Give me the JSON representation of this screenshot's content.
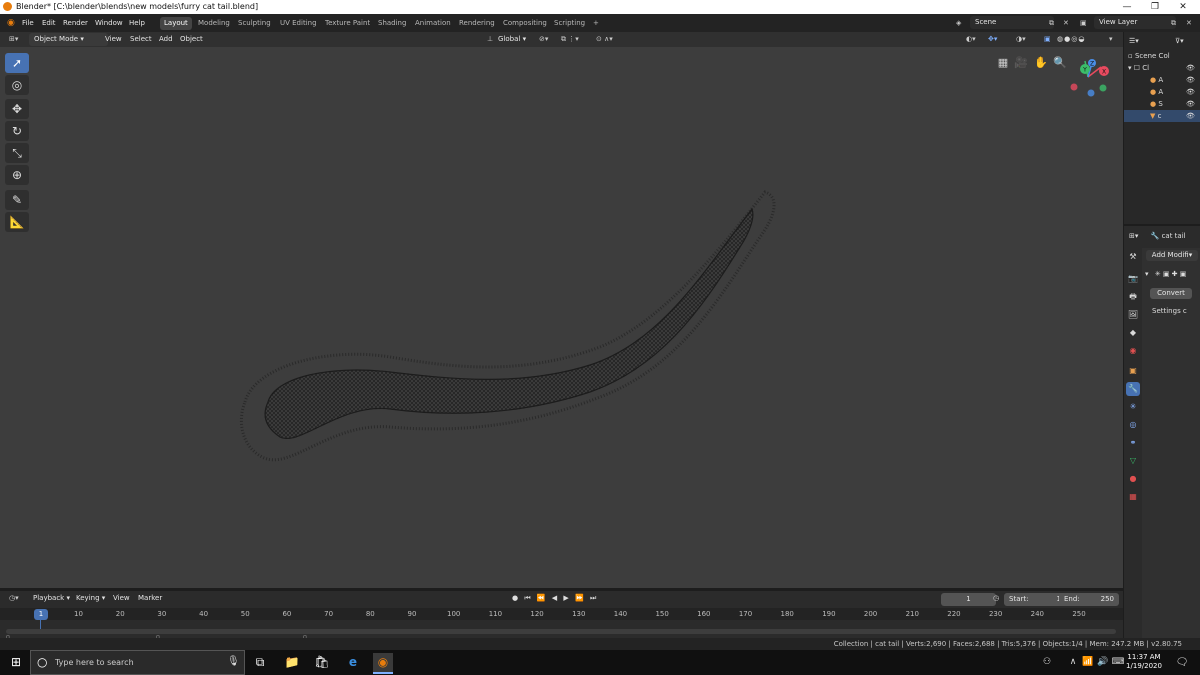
{
  "window": {
    "title": "Blender* [C:\\blender\\blends\\new models\\furry cat tail.blend]",
    "minimize": "—",
    "maximize": "❐",
    "close": "✕"
  },
  "menus": [
    "File",
    "Edit",
    "Render",
    "Window",
    "Help"
  ],
  "workspaces": [
    "Layout",
    "Modeling",
    "Sculpting",
    "UV Editing",
    "Texture Paint",
    "Shading",
    "Animation",
    "Rendering",
    "Compositing",
    "Scripting"
  ],
  "workspace_add": "+",
  "scene": {
    "label": "Scene"
  },
  "view_layer": {
    "label": "View Layer"
  },
  "viewport_header": {
    "mode": "Object Mode",
    "menus": [
      "View",
      "Select",
      "Add",
      "Object"
    ],
    "orientation": "Global"
  },
  "gizmo": {
    "x": "X",
    "y": "Y",
    "z": "Z"
  },
  "outliner": {
    "header": "Scene Col",
    "items": [
      "Cl",
      "A",
      "A",
      "S",
      "c"
    ]
  },
  "properties": {
    "object_name": "cat tail",
    "add_modifier": "Add Modifi",
    "convert_button": "Convert",
    "settings_label": "Settings c"
  },
  "timeline": {
    "menus": [
      "Playback",
      "Keying",
      "View",
      "Marker"
    ],
    "current_frame": "1",
    "start_label": "Start:",
    "start_value": "1",
    "end_label": "End:",
    "end_value": "250",
    "ticks": [
      "1",
      "10",
      "20",
      "30",
      "40",
      "50",
      "60",
      "70",
      "80",
      "90",
      "100",
      "110",
      "120",
      "130",
      "140",
      "150",
      "160",
      "170",
      "180",
      "190",
      "200",
      "210",
      "220",
      "230",
      "240",
      "250"
    ]
  },
  "status_bar": {
    "text": "Collection | cat tail | Verts:2,690 | Faces:2,688 | Tris:5,376 | Objects:1/4 | Mem: 247.2 MB | v2.80.75"
  },
  "taskbar": {
    "search_placeholder": "Type here to search",
    "time": "11:37 AM",
    "date": "1/19/2020"
  }
}
